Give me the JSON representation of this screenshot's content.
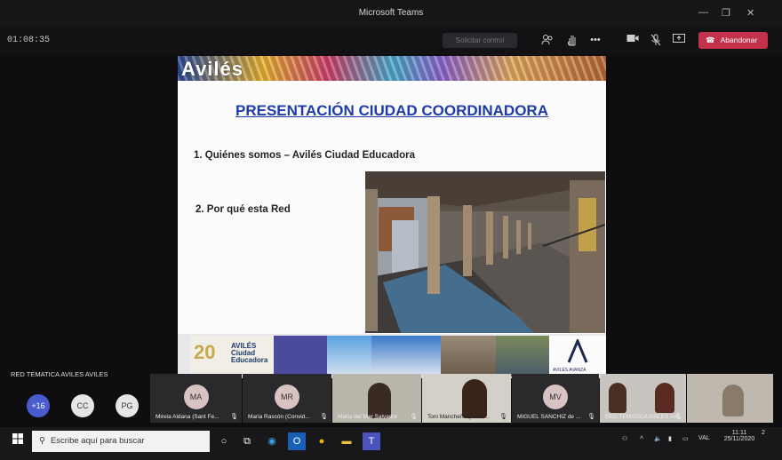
{
  "window": {
    "title": "Microsoft Teams",
    "minimize": "—",
    "maximize": "❐",
    "close": "✕"
  },
  "toolbar": {
    "timer": "01:08:35",
    "request_control": "Solicitar control",
    "leave_label": "Abandonar"
  },
  "slide": {
    "logo": "Avilés",
    "title": "PRESENTACIÓN CIUDAD COORDINADORA",
    "items": [
      "1.  Quiénes somos – Avilés Ciudad Educadora",
      "2. Por qué esta Red"
    ],
    "strip_logo_lines": [
      "AVILÉS",
      "Ciudad",
      "Educadora"
    ],
    "strip_avanza": "AVILÉS AVANZA"
  },
  "meeting": {
    "name": "RED TEMATICA AVILES AVILES",
    "avatars": [
      {
        "label": "+16",
        "color": "#4a5bd0"
      },
      {
        "label": "CC",
        "color": "#e6e6e6"
      },
      {
        "label": "PG",
        "color": "#e6e6e6"
      }
    ],
    "tiles": [
      {
        "initials": "MA",
        "name": "Mireia Aldana (Sant Fe...",
        "mic": "🎤"
      },
      {
        "initials": "MR",
        "name": "Maria Rascón (Convid...",
        "mic": "🎤"
      },
      {
        "initials": "",
        "name": "Maria del Mar Salvador",
        "mic": "🎤"
      },
      {
        "initials": "",
        "name": "Toni Mancheño (Sevill...",
        "mic": "🎤"
      },
      {
        "initials": "MV",
        "name": "MIGUEL SANCHIZ de ...",
        "mic": "🎤"
      },
      {
        "initials": "",
        "name": "RED TEMATICA AVILES AVI...",
        "mic": "🎤"
      },
      {
        "initials": "",
        "name": "",
        "mic": ""
      }
    ]
  },
  "taskbar": {
    "search_placeholder": "Escribe aquí para buscar",
    "lang": "VAL",
    "time": "11:11",
    "date": "25/11/2020",
    "notifications": "2"
  }
}
